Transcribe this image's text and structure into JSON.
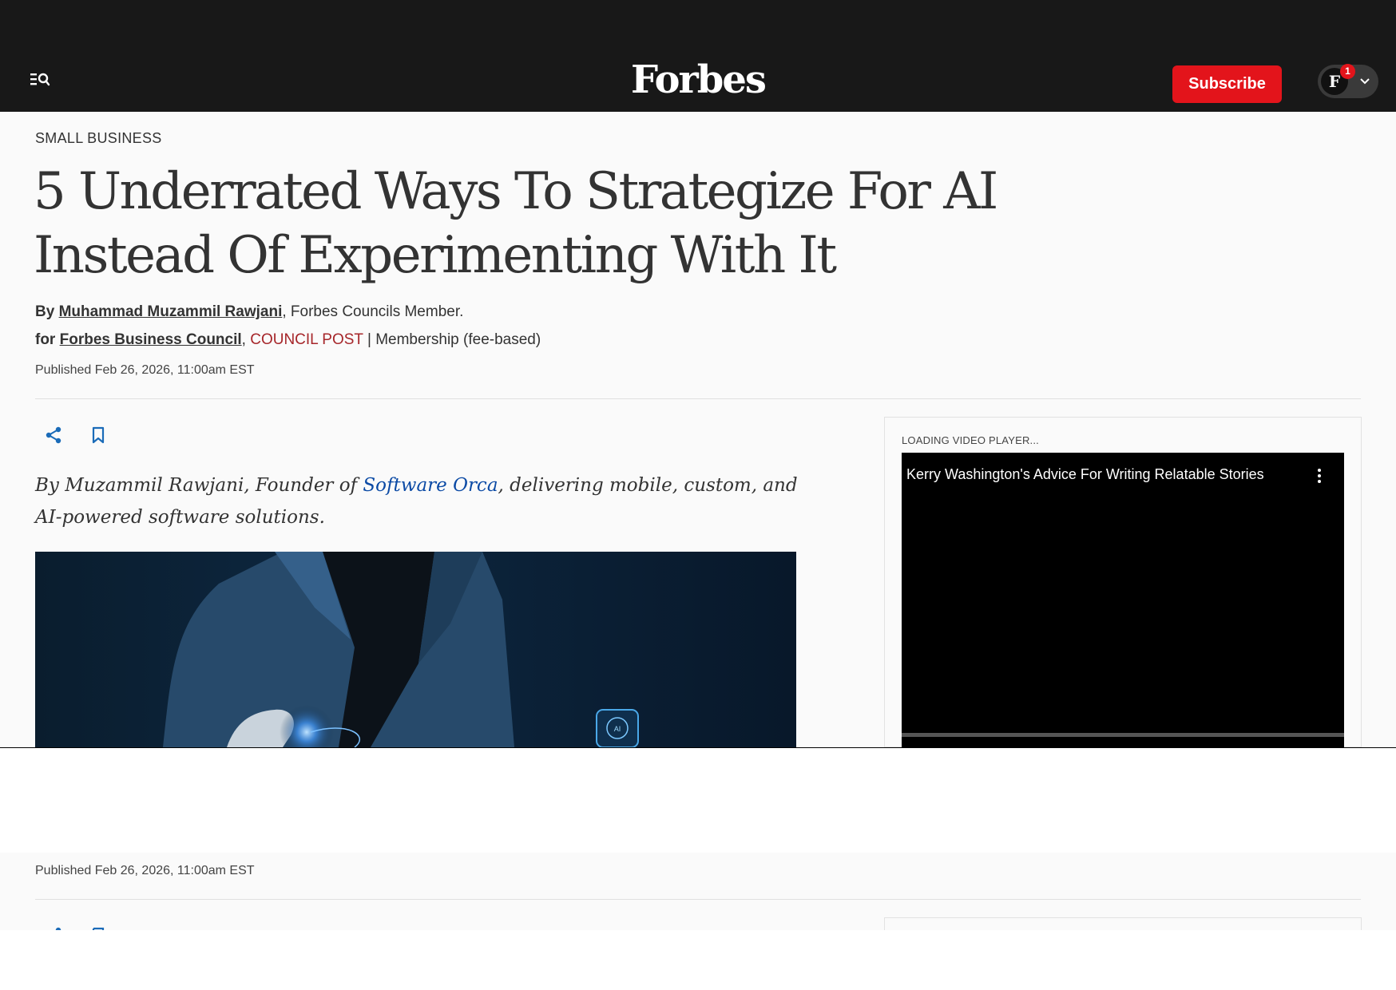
{
  "header": {
    "logo": "Forbes",
    "subscribe_label": "Subscribe",
    "account_initial": "F",
    "notification_count": "1",
    "icons": [
      "search-menu-icon",
      "chevron-down-icon"
    ]
  },
  "article": {
    "section": "SMALL BUSINESS",
    "headline": "5 Underrated Ways To Strategize For AI Instead Of Experimenting With It",
    "byline": {
      "prefix": "By",
      "author": "Muhammad Muzammil Rawjani",
      "suffix": "Forbes Councils Member."
    },
    "for_line": {
      "prefix": "for",
      "council": "Forbes Business Council",
      "tag": "COUNCIL POST",
      "membership": "Membership (fee-based)"
    },
    "published": "Published Feb 26, 2026, 11:00am EST",
    "intro": {
      "before": "By Muzammil Rawjani, Founder of ",
      "link": "Software Orca",
      "after": ", delivering mobile, custom, and AI-powered software solutions."
    },
    "actions": [
      "share-icon",
      "bookmark-icon"
    ],
    "hero_badge": "AI"
  },
  "video": {
    "loading_label": "LOADING VIDEO PLAYER...",
    "title": "Kerry Washington's Advice For Writing Relatable Stories"
  },
  "lower_strip": {
    "published": "Published Feb 26, 2026, 11:00am EST"
  },
  "colors": {
    "header_bg": "#181818",
    "subscribe": "#e3141b",
    "council_tag": "#a6262a",
    "link": "#0b4aa5",
    "share_icon": "#1a6bb8"
  }
}
